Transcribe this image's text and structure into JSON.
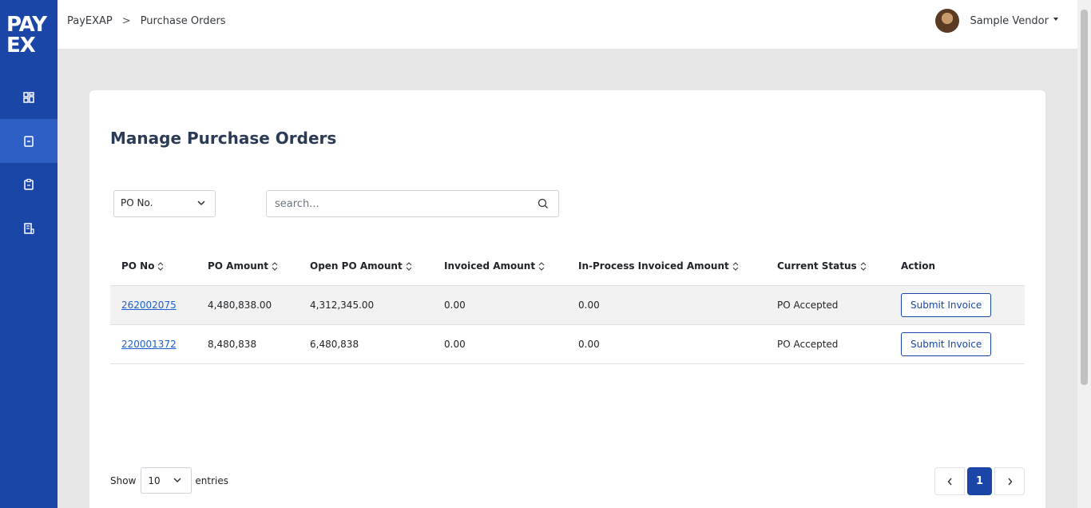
{
  "app": {
    "logo_line1": "PAY",
    "logo_line2": "EX"
  },
  "sidebar": {
    "items": [
      {
        "icon": "dashboard-icon",
        "active": false
      },
      {
        "icon": "purchase-order-icon",
        "active": true
      },
      {
        "icon": "clipboard-icon",
        "active": false
      },
      {
        "icon": "invoice-icon",
        "active": false
      }
    ]
  },
  "breadcrumb": {
    "root": "PayEXAP",
    "separator": ">",
    "current": "Purchase Orders"
  },
  "user": {
    "name": "Sample Vendor"
  },
  "page": {
    "title": "Manage Purchase Orders"
  },
  "filter": {
    "selected": "PO No.",
    "search_placeholder": "search..."
  },
  "table": {
    "headers": [
      "PO No",
      "PO Amount",
      "Open PO Amount",
      "Invoiced Amount",
      "In-Process Invoiced Amount",
      "Current Status",
      "Action"
    ],
    "rows": [
      {
        "po_no": "262002075",
        "po_amount": "4,480,838.00",
        "open_po_amount": "4,312,345.00",
        "invoiced_amount": "0.00",
        "in_process_amount": "0.00",
        "status": "PO Accepted",
        "action": "Submit Invoice"
      },
      {
        "po_no": "220001372",
        "po_amount": "8,480,838",
        "open_po_amount": "6,480,838",
        "invoiced_amount": "0.00",
        "in_process_amount": "0.00",
        "status": "PO Accepted",
        "action": "Submit Invoice"
      }
    ]
  },
  "footer": {
    "show_label": "Show",
    "page_length": "10",
    "entries_label": "entries",
    "current_page": "1"
  },
  "colors": {
    "sidebar": "#1a46a8",
    "sidebar_active": "#2d5fc4",
    "link": "#1a5fd1",
    "title": "#2b3a55"
  }
}
